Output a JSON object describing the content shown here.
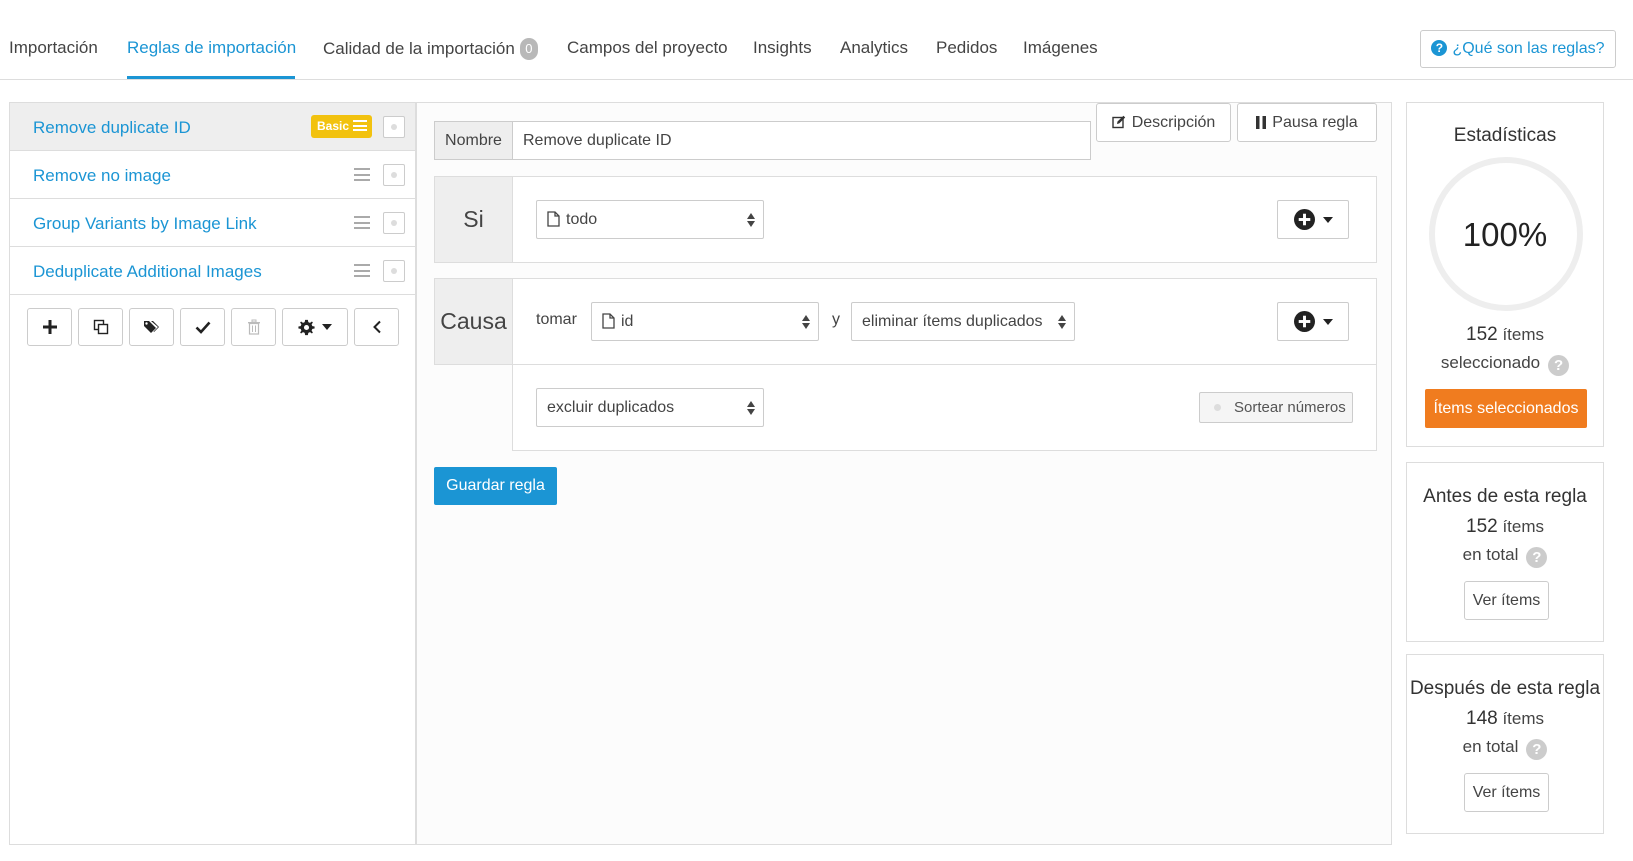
{
  "tabs": {
    "items": [
      {
        "label": "Importación"
      },
      {
        "label": "Reglas de importación"
      },
      {
        "label": "Calidad de la importación"
      },
      {
        "label": "Campos del proyecto"
      },
      {
        "label": "Insights"
      },
      {
        "label": "Analytics"
      },
      {
        "label": "Pedidos"
      },
      {
        "label": "Imágenes"
      }
    ],
    "active_index": 1,
    "quality_badge": "0",
    "help_label": "¿Qué son las reglas?"
  },
  "rules": {
    "items": [
      {
        "label": "Remove duplicate ID",
        "badge": "Basic",
        "active": true
      },
      {
        "label": "Remove no image",
        "active": false
      },
      {
        "label": "Group Variants by Image Link",
        "active": false
      },
      {
        "label": "Deduplicate Additional Images",
        "active": false
      }
    ],
    "toolbar_icons": [
      "plus-icon",
      "copy-icon",
      "tags-icon",
      "check-icon",
      "trash-icon",
      "gear-icon",
      "chevron-left-icon"
    ]
  },
  "editor": {
    "name_label": "Nombre",
    "name_value": "Remove duplicate ID",
    "description_label": "Descripción",
    "pause_label": "Pausa regla",
    "si": {
      "label": "Si",
      "select_value": "todo"
    },
    "causa": {
      "label": "Causa",
      "take_label": "tomar",
      "field_value": "id",
      "and_label": "y",
      "action_value": "eliminar ítems duplicados",
      "mode_value": "excluir duplicados",
      "sort_label": "Sortear números"
    },
    "save_label": "Guardar regla"
  },
  "stats": {
    "title": "Estadísticas",
    "percent": "100%",
    "percent_value": 1.0,
    "selected_count": "152",
    "items_word": "ítems",
    "selected_word": "seleccionado",
    "selected_button": "Ítems seleccionados",
    "before": {
      "title": "Antes de esta regla",
      "count": "152",
      "total_word": "en total",
      "button": "Ver ítems"
    },
    "after": {
      "title": "Después de esta regla",
      "count": "148",
      "total_word": "en total",
      "button": "Ver ítems"
    }
  },
  "colors": {
    "accent": "#1b95d4",
    "orange": "#f07c1f",
    "badge_yellow": "#f2c20f"
  }
}
